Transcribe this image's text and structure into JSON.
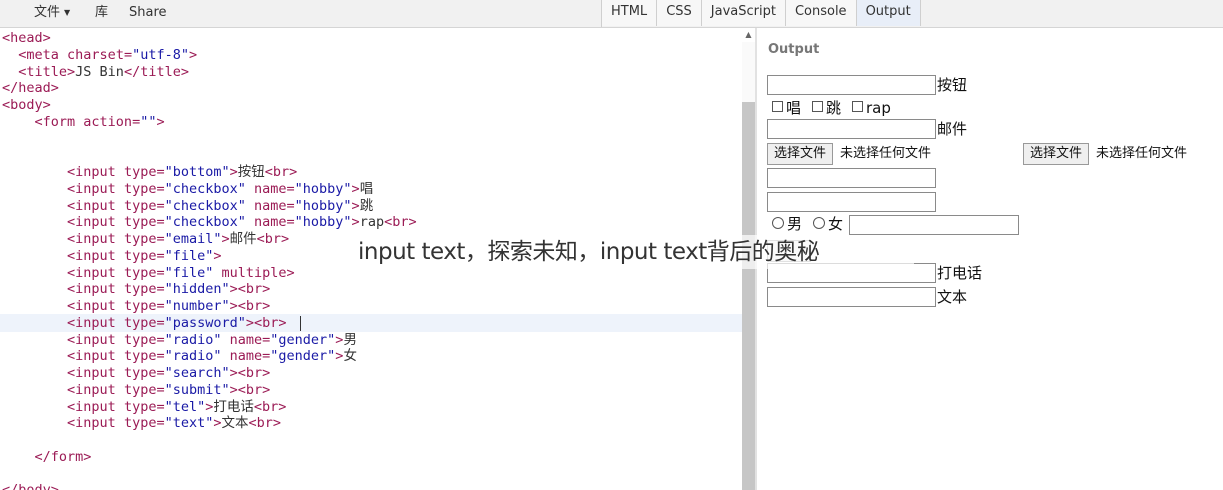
{
  "menu": {
    "file": "文件",
    "library": "库",
    "share": "Share"
  },
  "tabs": [
    "HTML",
    "CSS",
    "JavaScript",
    "Console",
    "Output"
  ],
  "editor_lines": [
    [
      {
        "t": "<head>",
        "c": "#9b1b55"
      }
    ],
    [
      {
        "t": "  "
      },
      {
        "t": "<meta ",
        "c": "#9b1b55"
      },
      {
        "t": "charset=",
        "c": "#9b1b55"
      },
      {
        "t": "\"utf-8\"",
        "c": "#1a1aa6"
      },
      {
        "t": ">",
        "c": "#9b1b55"
      }
    ],
    [
      {
        "t": "  "
      },
      {
        "t": "<title>",
        "c": "#9b1b55"
      },
      {
        "t": "JS Bin",
        "c": "#333"
      },
      {
        "t": "</title>",
        "c": "#9b1b55"
      }
    ],
    [
      {
        "t": "</head>",
        "c": "#9b1b55"
      }
    ],
    [
      {
        "t": "<body>",
        "c": "#9b1b55"
      }
    ],
    [
      {
        "t": "    "
      },
      {
        "t": "<form ",
        "c": "#9b1b55"
      },
      {
        "t": "action=",
        "c": "#9b1b55"
      },
      {
        "t": "\"\"",
        "c": "#1a1aa6"
      },
      {
        "t": ">",
        "c": "#9b1b55"
      }
    ],
    [],
    [],
    [
      {
        "t": "        "
      },
      {
        "t": "<input ",
        "c": "#9b1b55"
      },
      {
        "t": "type=",
        "c": "#9b1b55"
      },
      {
        "t": "\"bottom\"",
        "c": "#1a1aa6"
      },
      {
        "t": ">",
        "c": "#9b1b55"
      },
      {
        "t": "按钮",
        "c": "#333"
      },
      {
        "t": "<br>",
        "c": "#9b1b55"
      }
    ],
    [
      {
        "t": "        "
      },
      {
        "t": "<input ",
        "c": "#9b1b55"
      },
      {
        "t": "type=",
        "c": "#9b1b55"
      },
      {
        "t": "\"checkbox\"",
        "c": "#1a1aa6"
      },
      {
        "t": " name=",
        "c": "#9b1b55"
      },
      {
        "t": "\"hobby\"",
        "c": "#1a1aa6"
      },
      {
        "t": ">",
        "c": "#9b1b55"
      },
      {
        "t": "唱",
        "c": "#333"
      }
    ],
    [
      {
        "t": "        "
      },
      {
        "t": "<input ",
        "c": "#9b1b55"
      },
      {
        "t": "type=",
        "c": "#9b1b55"
      },
      {
        "t": "\"checkbox\"",
        "c": "#1a1aa6"
      },
      {
        "t": " name=",
        "c": "#9b1b55"
      },
      {
        "t": "\"hobby\"",
        "c": "#1a1aa6"
      },
      {
        "t": ">",
        "c": "#9b1b55"
      },
      {
        "t": "跳",
        "c": "#333"
      }
    ],
    [
      {
        "t": "        "
      },
      {
        "t": "<input ",
        "c": "#9b1b55"
      },
      {
        "t": "type=",
        "c": "#9b1b55"
      },
      {
        "t": "\"checkbox\"",
        "c": "#1a1aa6"
      },
      {
        "t": " name=",
        "c": "#9b1b55"
      },
      {
        "t": "\"hobby\"",
        "c": "#1a1aa6"
      },
      {
        "t": ">",
        "c": "#9b1b55"
      },
      {
        "t": "rap",
        "c": "#333"
      },
      {
        "t": "<br>",
        "c": "#9b1b55"
      }
    ],
    [
      {
        "t": "        "
      },
      {
        "t": "<input ",
        "c": "#9b1b55"
      },
      {
        "t": "type=",
        "c": "#9b1b55"
      },
      {
        "t": "\"email\"",
        "c": "#1a1aa6"
      },
      {
        "t": ">",
        "c": "#9b1b55"
      },
      {
        "t": "邮件",
        "c": "#333"
      },
      {
        "t": "<br>",
        "c": "#9b1b55"
      }
    ],
    [
      {
        "t": "        "
      },
      {
        "t": "<input ",
        "c": "#9b1b55"
      },
      {
        "t": "type=",
        "c": "#9b1b55"
      },
      {
        "t": "\"file\"",
        "c": "#1a1aa6"
      },
      {
        "t": ">",
        "c": "#9b1b55"
      }
    ],
    [
      {
        "t": "        "
      },
      {
        "t": "<input ",
        "c": "#9b1b55"
      },
      {
        "t": "type=",
        "c": "#9b1b55"
      },
      {
        "t": "\"file\"",
        "c": "#1a1aa6"
      },
      {
        "t": " multiple",
        "c": "#9b1b55"
      },
      {
        "t": ">",
        "c": "#9b1b55"
      }
    ],
    [
      {
        "t": "        "
      },
      {
        "t": "<input ",
        "c": "#9b1b55"
      },
      {
        "t": "type=",
        "c": "#9b1b55"
      },
      {
        "t": "\"hidden\"",
        "c": "#1a1aa6"
      },
      {
        "t": ">",
        "c": "#9b1b55"
      },
      {
        "t": "<br>",
        "c": "#9b1b55"
      }
    ],
    [
      {
        "t": "        "
      },
      {
        "t": "<input ",
        "c": "#9b1b55"
      },
      {
        "t": "type=",
        "c": "#9b1b55"
      },
      {
        "t": "\"number\"",
        "c": "#1a1aa6"
      },
      {
        "t": ">",
        "c": "#9b1b55"
      },
      {
        "t": "<br>",
        "c": "#9b1b55"
      }
    ],
    [
      {
        "t": "        "
      },
      {
        "t": "<input ",
        "c": "#9b1b55"
      },
      {
        "t": "type=",
        "c": "#9b1b55"
      },
      {
        "t": "\"password\"",
        "c": "#1a1aa6"
      },
      {
        "t": ">",
        "c": "#9b1b55"
      },
      {
        "t": "<br>",
        "c": "#9b1b55"
      }
    ],
    [
      {
        "t": "        "
      },
      {
        "t": "<input ",
        "c": "#9b1b55"
      },
      {
        "t": "type=",
        "c": "#9b1b55"
      },
      {
        "t": "\"radio\"",
        "c": "#1a1aa6"
      },
      {
        "t": " name=",
        "c": "#9b1b55"
      },
      {
        "t": "\"gender\"",
        "c": "#1a1aa6"
      },
      {
        "t": ">",
        "c": "#9b1b55"
      },
      {
        "t": "男",
        "c": "#333"
      }
    ],
    [
      {
        "t": "        "
      },
      {
        "t": "<input ",
        "c": "#9b1b55"
      },
      {
        "t": "type=",
        "c": "#9b1b55"
      },
      {
        "t": "\"radio\"",
        "c": "#1a1aa6"
      },
      {
        "t": " name=",
        "c": "#9b1b55"
      },
      {
        "t": "\"gender\"",
        "c": "#1a1aa6"
      },
      {
        "t": ">",
        "c": "#9b1b55"
      },
      {
        "t": "女",
        "c": "#333"
      }
    ],
    [
      {
        "t": "        "
      },
      {
        "t": "<input ",
        "c": "#9b1b55"
      },
      {
        "t": "type=",
        "c": "#9b1b55"
      },
      {
        "t": "\"search\"",
        "c": "#1a1aa6"
      },
      {
        "t": ">",
        "c": "#9b1b55"
      },
      {
        "t": "<br>",
        "c": "#9b1b55"
      }
    ],
    [
      {
        "t": "        "
      },
      {
        "t": "<input ",
        "c": "#9b1b55"
      },
      {
        "t": "type=",
        "c": "#9b1b55"
      },
      {
        "t": "\"submit\"",
        "c": "#1a1aa6"
      },
      {
        "t": ">",
        "c": "#9b1b55"
      },
      {
        "t": "<br>",
        "c": "#9b1b55"
      }
    ],
    [
      {
        "t": "        "
      },
      {
        "t": "<input ",
        "c": "#9b1b55"
      },
      {
        "t": "type=",
        "c": "#9b1b55"
      },
      {
        "t": "\"tel\"",
        "c": "#1a1aa6"
      },
      {
        "t": ">",
        "c": "#9b1b55"
      },
      {
        "t": "打电话",
        "c": "#333"
      },
      {
        "t": "<br>",
        "c": "#9b1b55"
      }
    ],
    [
      {
        "t": "        "
      },
      {
        "t": "<input ",
        "c": "#9b1b55"
      },
      {
        "t": "type=",
        "c": "#9b1b55"
      },
      {
        "t": "\"text\"",
        "c": "#1a1aa6"
      },
      {
        "t": ">",
        "c": "#9b1b55"
      },
      {
        "t": "文本",
        "c": "#333"
      },
      {
        "t": "<br>",
        "c": "#9b1b55"
      }
    ],
    [],
    [
      {
        "t": "    "
      },
      {
        "t": "</form>",
        "c": "#9b1b55"
      }
    ],
    [],
    [
      {
        "t": "</body>",
        "c": "#9b1b55"
      }
    ]
  ],
  "output": {
    "title": "Output",
    "button_label": "按钮",
    "hobby_1": "唱",
    "hobby_2": "跳",
    "hobby_3": "rap",
    "email_label": "邮件",
    "file_button": "选择文件",
    "file_none": "未选择任何文件",
    "gender_male": "男",
    "gender_female": "女",
    "tel_label": "打电话",
    "text_label": "文本"
  },
  "overlay_caption": "input text，探索未知，input text背后的奥秘",
  "colors": {
    "tag": "#9b1b55",
    "attr_value": "#1a1aa6",
    "active_line": "#eef3fb"
  }
}
